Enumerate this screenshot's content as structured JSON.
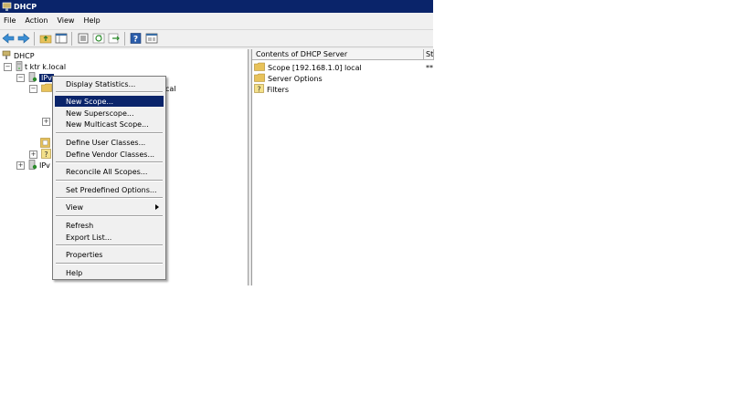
{
  "window": {
    "title": "DHCP"
  },
  "menu": [
    "File",
    "Action",
    "View",
    "Help"
  ],
  "toolbar_icons": [
    "back-arrow-icon",
    "forward-arrow-icon",
    "up-folder-icon",
    "show-tree-icon",
    "properties-icon",
    "refresh-icon",
    "export-icon",
    "help-icon",
    "console-icon"
  ],
  "tree": {
    "root": "DHCP",
    "server": "t      ktr      k.local",
    "ipv4": "IPv",
    "scope_partial": "cal",
    "ipv6": "IPv"
  },
  "right_pane": {
    "header": "Contents of DHCP Server",
    "header2": "St",
    "items": [
      {
        "label": "Scope [192.168.1.0]       local",
        "status": "**",
        "icon": "folder-icon"
      },
      {
        "label": "Server Options",
        "icon": "folder-icon"
      },
      {
        "label": "Filters",
        "icon": "filter-icon"
      }
    ]
  },
  "context_menu": {
    "items": [
      "Display Statistics...",
      "New Scope...",
      "New Superscope...",
      "New Multicast Scope...",
      "Define User Classes...",
      "Define Vendor Classes...",
      "Reconcile All Scopes...",
      "Set Predefined Options...",
      "View",
      "Refresh",
      "Export List...",
      "Properties",
      "Help"
    ],
    "highlighted": "New Scope..."
  },
  "colors": {
    "titlebar": "#0a246a",
    "selection": "#0a246a",
    "folder": "#e8c25a"
  }
}
